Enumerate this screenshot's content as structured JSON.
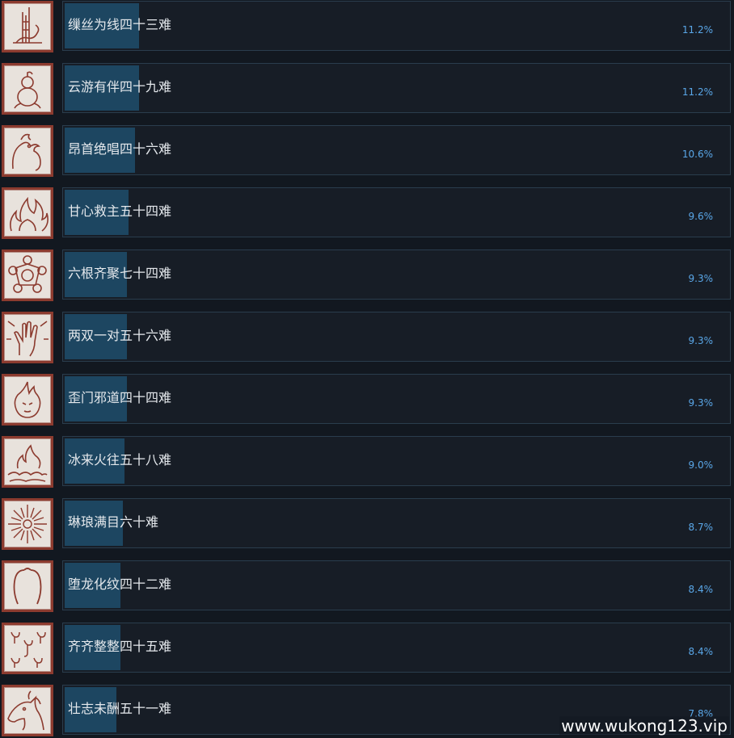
{
  "achievements": [
    {
      "name": "缫丝为线四十三难",
      "percent": "11.2%",
      "percent_value": 11.2,
      "icon": "tower-icon"
    },
    {
      "name": "云游有伴四十九难",
      "percent": "11.2%",
      "percent_value": 11.2,
      "icon": "gourd-icon"
    },
    {
      "name": "昂首绝唱四十六难",
      "percent": "10.6%",
      "percent_value": 10.6,
      "icon": "rooster-icon"
    },
    {
      "name": "甘心救主五十四难",
      "percent": "9.6%",
      "percent_value": 9.6,
      "icon": "flames-icon"
    },
    {
      "name": "六根齐聚七十四难",
      "percent": "9.3%",
      "percent_value": 9.3,
      "icon": "six-circles-icon"
    },
    {
      "name": "两双一对五十六难",
      "percent": "9.3%",
      "percent_value": 9.3,
      "icon": "hand-icon"
    },
    {
      "name": "歪门邪道四十四难",
      "percent": "9.3%",
      "percent_value": 9.3,
      "icon": "flame-face-icon"
    },
    {
      "name": "冰来火往五十八难",
      "percent": "9.0%",
      "percent_value": 9.0,
      "icon": "fire-ice-icon"
    },
    {
      "name": "琳琅满目六十难",
      "percent": "8.7%",
      "percent_value": 8.7,
      "icon": "starburst-icon"
    },
    {
      "name": "堕龙化纹四十二难",
      "percent": "8.4%",
      "percent_value": 8.4,
      "icon": "dragon-whiskers-icon"
    },
    {
      "name": "齐齐整整四十五难",
      "percent": "8.4%",
      "percent_value": 8.4,
      "icon": "scorpions-icon"
    },
    {
      "name": "壮志未酬五十一难",
      "percent": "7.8%",
      "percent_value": 7.8,
      "icon": "horse-head-icon"
    }
  ],
  "watermark": "www.wukong123.vip",
  "colors": {
    "background": "#121820",
    "bar_fill": "#1d4661",
    "bar_border": "#2a3d4d",
    "percent_text": "#5aa7e8",
    "icon_frame": "#8c3b2f"
  }
}
